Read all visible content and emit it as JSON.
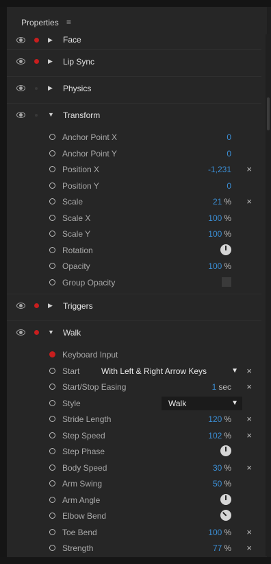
{
  "panel": {
    "title": "Properties",
    "menu_glyph": "≡"
  },
  "groups": [
    {
      "name": "Face",
      "rec": true,
      "expanded": false
    },
    {
      "name": "Lip Sync",
      "rec": true,
      "expanded": false
    },
    {
      "name": "Physics",
      "rec": false,
      "expanded": false
    },
    {
      "name": "Transform",
      "rec": false,
      "expanded": true,
      "rows": [
        {
          "label": "Anchor Point X",
          "value": "0"
        },
        {
          "label": "Anchor Point Y",
          "value": "0"
        },
        {
          "label": "Position X",
          "value": "-1,231",
          "reset": true
        },
        {
          "label": "Position Y",
          "value": "0"
        },
        {
          "label": "Scale",
          "value": "21",
          "unit": "%",
          "reset": true
        },
        {
          "label": "Scale X",
          "value": "100",
          "unit": "%"
        },
        {
          "label": "Scale Y",
          "value": "100",
          "unit": "%"
        },
        {
          "label": "Rotation",
          "control": "dial"
        },
        {
          "label": "Opacity",
          "value": "100",
          "unit": "%"
        },
        {
          "label": "Group Opacity",
          "control": "checkbox"
        }
      ]
    },
    {
      "name": "Triggers",
      "rec": true,
      "expanded": false
    },
    {
      "name": "Walk",
      "rec": true,
      "expanded": true,
      "rows": [
        {
          "label": "Keyboard Input",
          "marker": "red"
        },
        {
          "label": "Start",
          "control": "select",
          "value": "With Left & Right Arrow Keys",
          "reset": true
        },
        {
          "label": "Start/Stop Easing",
          "value": "1",
          "unit": "sec",
          "reset": true
        },
        {
          "label": "Style",
          "control": "select-short",
          "value": "Walk"
        },
        {
          "label": "Stride Length",
          "value": "120",
          "unit": "%",
          "reset": true
        },
        {
          "label": "Step Speed",
          "value": "102",
          "unit": "%",
          "reset": true
        },
        {
          "label": "Step Phase",
          "control": "dial"
        },
        {
          "label": "Body Speed",
          "value": "30",
          "unit": "%",
          "reset": true
        },
        {
          "label": "Arm Swing",
          "value": "50",
          "unit": "%"
        },
        {
          "label": "Arm Angle",
          "control": "dial"
        },
        {
          "label": "Elbow Bend",
          "control": "dial-tilt"
        },
        {
          "label": "Toe Bend",
          "value": "100",
          "unit": "%",
          "reset": true
        },
        {
          "label": "Strength",
          "value": "77",
          "unit": "%",
          "reset": true
        }
      ]
    }
  ],
  "icons": {
    "eye": "eye-icon",
    "record": "record-dot-icon",
    "collapsed": "triangle-right-icon",
    "expanded": "triangle-down-icon",
    "stopwatch": "stopwatch-circle-icon",
    "reset": "close-icon",
    "dropdown": "chevron-down-icon",
    "dial": "angle-dial-icon"
  },
  "colors": {
    "value_blue": "#3b8fd6",
    "record_red": "#c81e1e",
    "panel_bg": "#262626"
  },
  "glyphs": {
    "collapsed": "▶",
    "expanded": "▼",
    "reset": "×",
    "dropdown": "▼"
  }
}
